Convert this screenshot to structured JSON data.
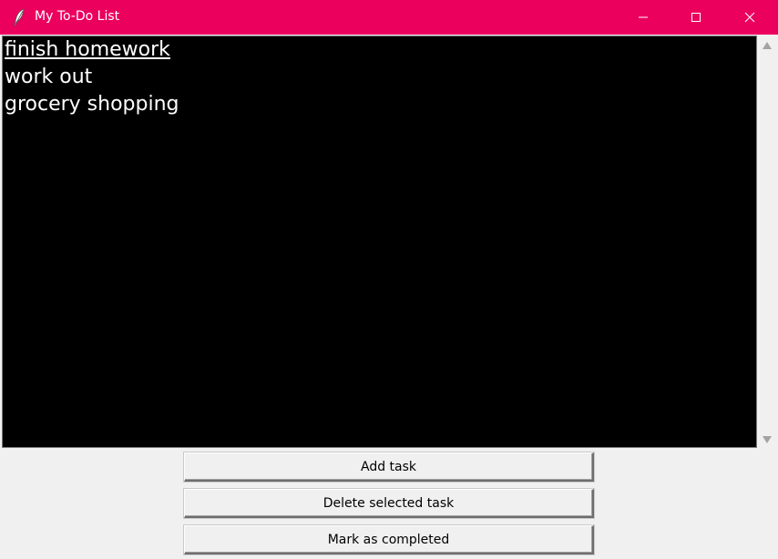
{
  "window": {
    "title": "My To-Do List",
    "accent_color": "#eb005e",
    "controls": [
      "minimize-icon",
      "maximize-icon",
      "close-icon"
    ]
  },
  "tasks": [
    {
      "label": "finish homework",
      "active": true
    },
    {
      "label": "work out",
      "active": false
    },
    {
      "label": "grocery shopping",
      "active": false
    }
  ],
  "buttons": {
    "add_label": "Add task",
    "delete_label": "Delete selected task",
    "complete_label": "Mark as completed"
  }
}
